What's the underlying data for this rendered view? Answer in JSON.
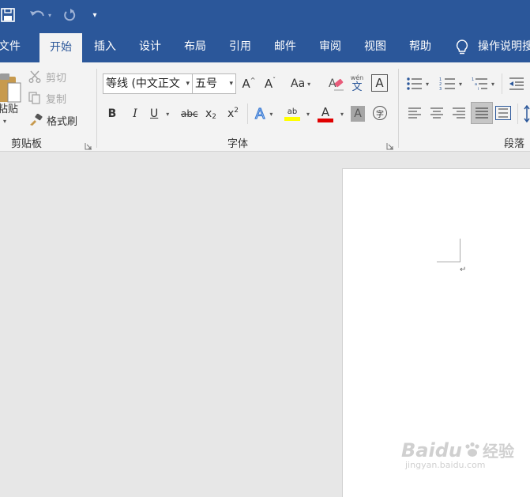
{
  "quick_access": {
    "customize": "▾"
  },
  "tabs": [
    {
      "label": "文件"
    },
    {
      "label": "开始"
    },
    {
      "label": "插入"
    },
    {
      "label": "设计"
    },
    {
      "label": "布局"
    },
    {
      "label": "引用"
    },
    {
      "label": "邮件"
    },
    {
      "label": "审阅"
    },
    {
      "label": "视图"
    },
    {
      "label": "帮助"
    }
  ],
  "tell_me": {
    "label": "操作说明搜"
  },
  "clipboard": {
    "paste": "粘贴",
    "cut": "剪切",
    "copy": "复制",
    "format_painter": "格式刷",
    "group_label": "剪贴板"
  },
  "font": {
    "font_name": "等线 (中文正文",
    "font_size": "五号",
    "grow": "A",
    "shrink": "A",
    "change_case": "Aa",
    "phonetic_top": "wén",
    "phonetic_bottom": "文",
    "border_char": "A",
    "bold": "B",
    "italic": "I",
    "underline": "U",
    "strike": "abc",
    "subscript": "x",
    "sub_mark": "2",
    "superscript": "x",
    "sup_mark": "2",
    "effects": "A",
    "highlight": "ab",
    "font_color": "A",
    "shading": "A",
    "enclose": "字",
    "group_label": "字体"
  },
  "paragraph": {
    "group_label": "段落"
  },
  "document": {
    "paragraph_mark": "↵"
  },
  "watermark": {
    "brand": "Baidu",
    "brand_cn": "经验",
    "url": "jingyan.baidu.com"
  },
  "colors": {
    "ribbon": "#2b579a",
    "highlight_yellow": "#ffff00",
    "font_red": "#e00000",
    "effects_blue": "#3a7bd5"
  }
}
